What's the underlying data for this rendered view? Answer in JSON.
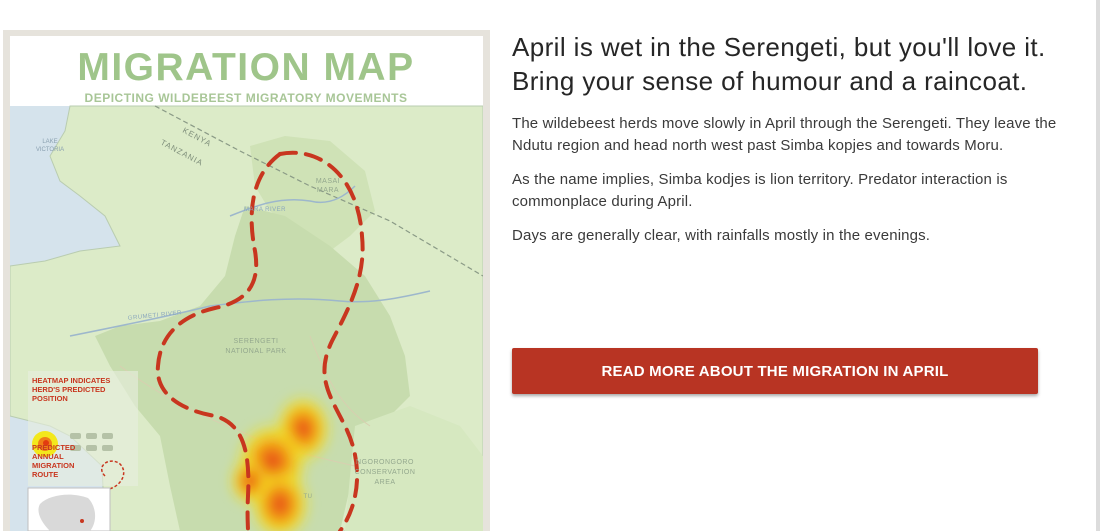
{
  "map": {
    "title": "MIGRATION MAP",
    "subtitle": "DEPICTING WILDEBEEST MIGRATORY MOVEMENTS",
    "labels": {
      "lake_victoria_1": "LAKE",
      "lake_victoria_2": "VICTORIA",
      "kenya": "KENYA",
      "tanzania": "TANZANIA",
      "masai_1": "MASAI",
      "masai_2": "MARA",
      "mara_river": "MARA RIVER",
      "grumeti_river": "GRUMETI RIVER",
      "serengeti_1": "SERENGETI",
      "serengeti_2": "NATIONAL PARK",
      "ngorongoro_1": "NGORONGORO",
      "ngorongoro_2": "CONSERVATION",
      "ngorongoro_3": "AREA",
      "tu": "TU"
    },
    "legend": {
      "heatmap_1": "HEATMAP INDICATES",
      "heatmap_2": "HERD'S PREDICTED",
      "heatmap_3": "POSITION",
      "route_1": "PREDICTED",
      "route_2": "ANNUAL",
      "route_3": "MIGRATION",
      "route_4": "ROUTE"
    },
    "colors": {
      "title": "#9fc58a",
      "legend": "#c8361f",
      "route": "#c8361f",
      "land": "#dcebc8",
      "park": "#c7dcae"
    }
  },
  "article": {
    "headline": "April is wet in the Serengeti, but you'll love it. Bring your sense of humour and a raincoat.",
    "paragraphs": [
      "The wildebeest herds move slowly in April through the Serengeti. They leave the Ndutu region and head north west past Simba kopjes and towards Moru.",
      "As the name implies, Simba kodjes is lion territory. Predator interaction is commonplace during April.",
      "Days are generally clear, with rainfalls mostly in the evenings."
    ],
    "cta_label": "READ MORE ABOUT THE MIGRATION IN APRIL",
    "colors": {
      "cta_bg": "#b83423",
      "cta_text": "#ffffff",
      "text": "#3a3a3a"
    }
  }
}
